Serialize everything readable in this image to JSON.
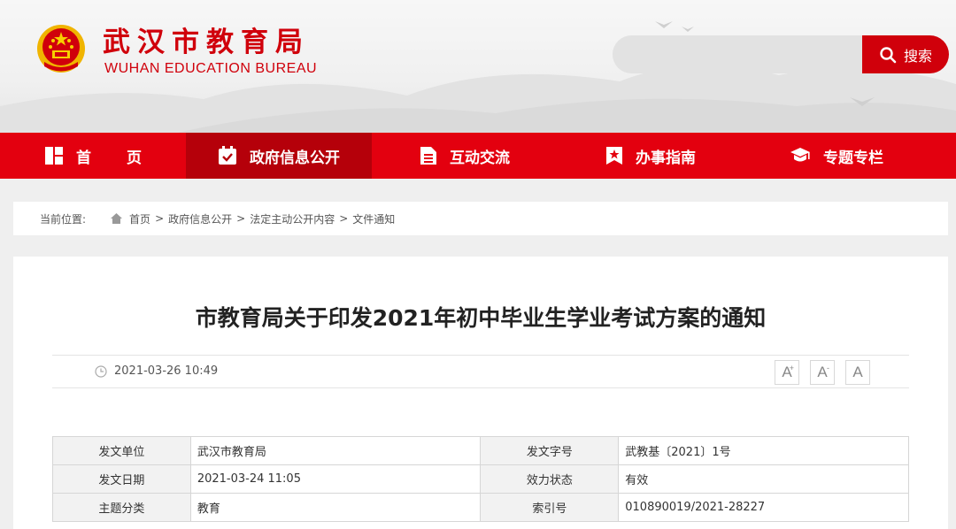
{
  "header": {
    "title_cn": "武汉市教育局",
    "title_en": "WUHAN EDUCATION BUREAU",
    "search_placeholder": "",
    "search_label": "搜索"
  },
  "nav": {
    "items": [
      {
        "label": "首页"
      },
      {
        "label": "政府信息公开",
        "active": true
      },
      {
        "label": "互动交流"
      },
      {
        "label": "办事指南"
      },
      {
        "label": "专题专栏"
      }
    ]
  },
  "breadcrumb": {
    "label": "当前位置:",
    "items": [
      "首页",
      "政府信息公开",
      "法定主动公开内容",
      "文件通知"
    ],
    "separator": ">"
  },
  "article": {
    "title": "市教育局关于印发2021年初中毕业生学业考试方案的通知",
    "date": "2021-03-26 10:49",
    "font_buttons": [
      "A+",
      "A-",
      "A"
    ],
    "info_rows": [
      {
        "k1": "发文单位",
        "v1": "武汉市教育局",
        "k2": "发文字号",
        "v2": "武教基〔2021〕1号"
      },
      {
        "k1": "发文日期",
        "v1": "2021-03-24 11:05",
        "k2": "效力状态",
        "v2": "有效"
      },
      {
        "k1": "主题分类",
        "v1": "教育",
        "k2": "索引号",
        "v2": "010890019/2021-28227"
      }
    ]
  },
  "colors": {
    "brand_red": "#e3000f",
    "active_red": "#b5000a"
  }
}
